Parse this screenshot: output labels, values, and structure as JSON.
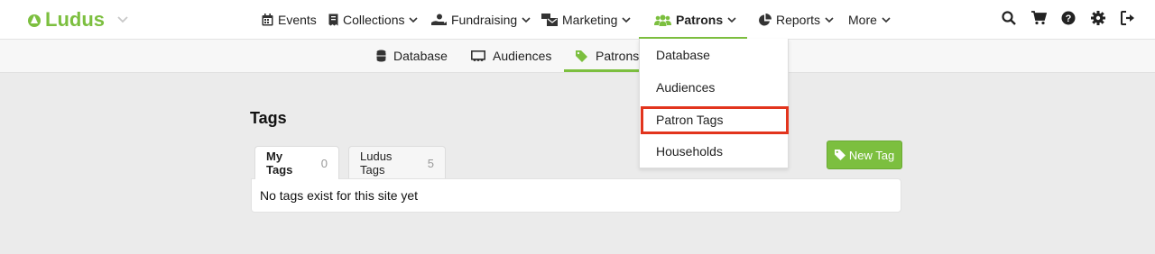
{
  "brand": {
    "name": "Ludus",
    "accent": "#7cbf3f"
  },
  "nav": {
    "items": [
      {
        "label": "Events",
        "icon": "calendar-icon"
      },
      {
        "label": "Collections",
        "icon": "receipt-icon"
      },
      {
        "label": "Fundraising",
        "icon": "donate-hand-icon"
      },
      {
        "label": "Marketing",
        "icon": "mail-bulk-icon"
      },
      {
        "label": "Patrons",
        "icon": "users-icon",
        "active": true
      },
      {
        "label": "Reports",
        "icon": "pie-chart-icon"
      },
      {
        "label": "More"
      }
    ],
    "right_icons": [
      "search-icon",
      "cart-icon",
      "help-icon",
      "gear-icon",
      "sign-out-icon"
    ]
  },
  "subnav": {
    "items": [
      {
        "label": "Database",
        "icon": "database-icon"
      },
      {
        "label": "Audiences",
        "icon": "audience-icon"
      },
      {
        "label": "Patrons",
        "icon": "tags-icon",
        "active": true
      }
    ]
  },
  "dropdown": {
    "items": [
      "Database",
      "Audiences",
      "Patron Tags",
      "Households"
    ],
    "highlighted": "Patron Tags"
  },
  "page": {
    "title": "Tags",
    "tabs": [
      {
        "label": "My Tags",
        "count": "0"
      },
      {
        "label": "Ludus Tags",
        "count": "5"
      }
    ],
    "empty_message": "No tags exist for this site yet",
    "new_button": "New Tag"
  }
}
